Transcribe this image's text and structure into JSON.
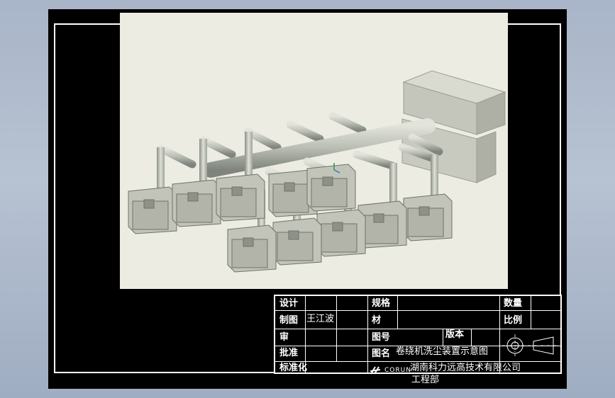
{
  "title_block": {
    "design_label": "设计",
    "drafter_label": "制图",
    "drafter_name": "王江波",
    "review_label": "审",
    "approve_label": "批准",
    "std_label": "标准化",
    "spec_label": "规格",
    "material_label": "材",
    "drawing_no_label": "图号",
    "version_label": "版本",
    "quantity_label": "数量",
    "scale_label": "比例",
    "drawing_name_label": "图名",
    "drawing_name": "卷绕机洗尘装置示意图",
    "logo_text": "CORUN",
    "company": "湖南科力远高技术有限公司",
    "department": "工程部"
  }
}
